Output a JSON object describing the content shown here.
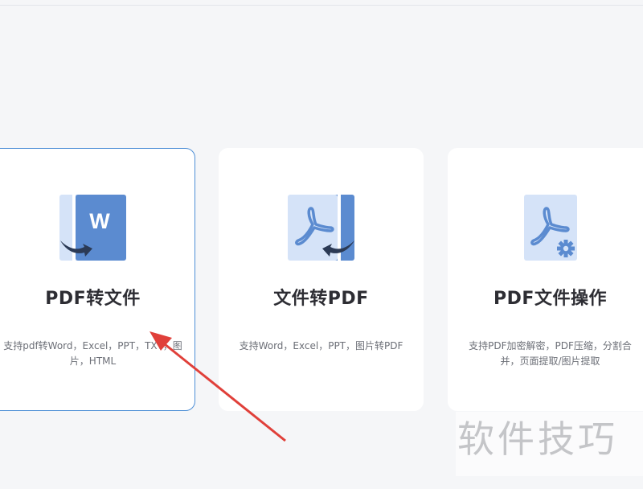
{
  "cards": [
    {
      "title": "PDF转文件",
      "description": "支持pdf转Word，Excel，PPT，TXT，图片，HTML",
      "icon": "pdf-to-word-icon",
      "active": true
    },
    {
      "title": "文件转PDF",
      "description": "支持Word，Excel，PPT，图片转PDF",
      "icon": "file-to-pdf-icon",
      "active": false
    },
    {
      "title": "PDF文件操作",
      "description": "支持PDF加密解密，PDF压缩，分割合并，页面提取/图片提取",
      "icon": "pdf-operations-icon",
      "active": false
    }
  ],
  "watermark": {
    "text": "软件技巧"
  },
  "colors": {
    "accent": "#4e8fd6",
    "icon_dark": "#5b8bd0",
    "icon_light": "#cfdff7",
    "arrow_annotation": "#e0403a"
  }
}
